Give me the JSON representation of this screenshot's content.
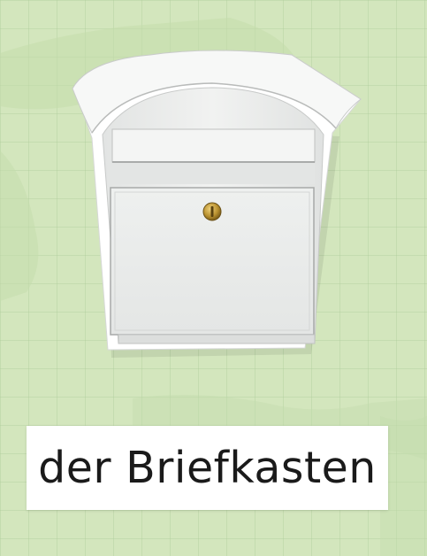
{
  "caption": {
    "text": "der Briefkasten"
  },
  "illustration": {
    "icon": "mailbox-icon",
    "colors": {
      "background": "#d3e6bd",
      "body": "#eceeed",
      "lock": "#b8902f"
    }
  }
}
